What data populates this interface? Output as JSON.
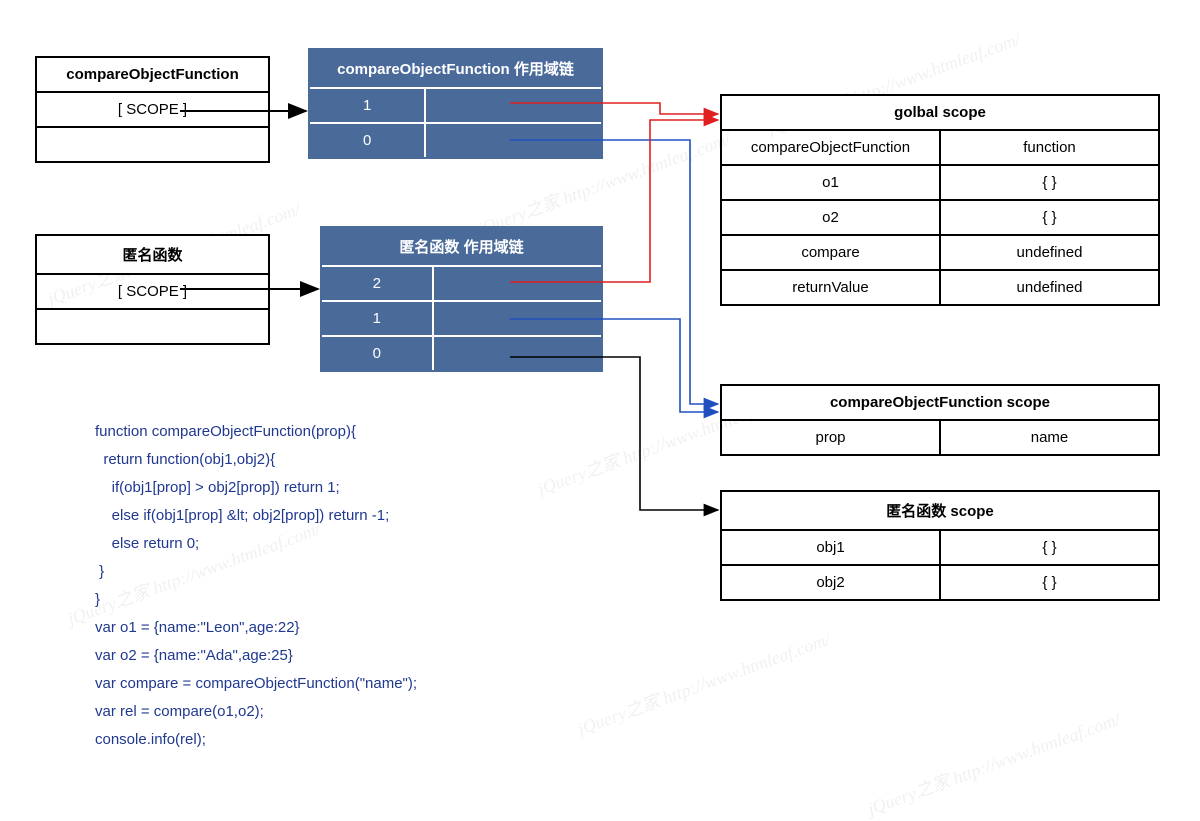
{
  "box_cof": {
    "title": "compareObjectFunction",
    "scope_label": "[ SCOPE ]"
  },
  "box_anon": {
    "title": "匿名函数",
    "scope_label": "[ SCOPE ]"
  },
  "chain_cof": {
    "title": "compareObjectFunction 作用域链",
    "indices": [
      "1",
      "0"
    ]
  },
  "chain_anon": {
    "title": "匿名函数 作用域链",
    "indices": [
      "2",
      "1",
      "0"
    ]
  },
  "global_scope": {
    "title": "golbal scope",
    "rows": [
      {
        "k": "compareObjectFunction",
        "v": "function"
      },
      {
        "k": "o1",
        "v": "{ }"
      },
      {
        "k": "o2",
        "v": "{ }"
      },
      {
        "k": "compare",
        "v": "undefined"
      },
      {
        "k": "returnValue",
        "v": "undefined"
      }
    ]
  },
  "cof_scope": {
    "title": "compareObjectFunction scope",
    "rows": [
      {
        "k": "prop",
        "v": "name"
      }
    ]
  },
  "anon_scope": {
    "title": "匿名函数 scope",
    "rows": [
      {
        "k": "obj1",
        "v": "{ }"
      },
      {
        "k": "obj2",
        "v": "{ }"
      }
    ]
  },
  "code": "function compareObjectFunction(prop){\n  return function(obj1,obj2){\n    if(obj1[prop] > obj2[prop]) return 1;\n    else if(obj1[prop] &lt; obj2[prop]) return -1;\n    else return 0;\n }\n}\nvar o1 = {name:\"Leon\",age:22}\nvar o2 = {name:\"Ada\",age:25}\nvar compare = compareObjectFunction(\"name\");\nvar rel = compare(o1,o2);\nconsole.info(rel);",
  "colors": {
    "blue_bg": "#4a6a9a",
    "code_color": "#203890",
    "arrow_red": "#e02020",
    "arrow_blue": "#2050c0",
    "arrow_black": "#000000"
  },
  "watermark_text": "jQuery之家   http://www.htmleaf.com/"
}
